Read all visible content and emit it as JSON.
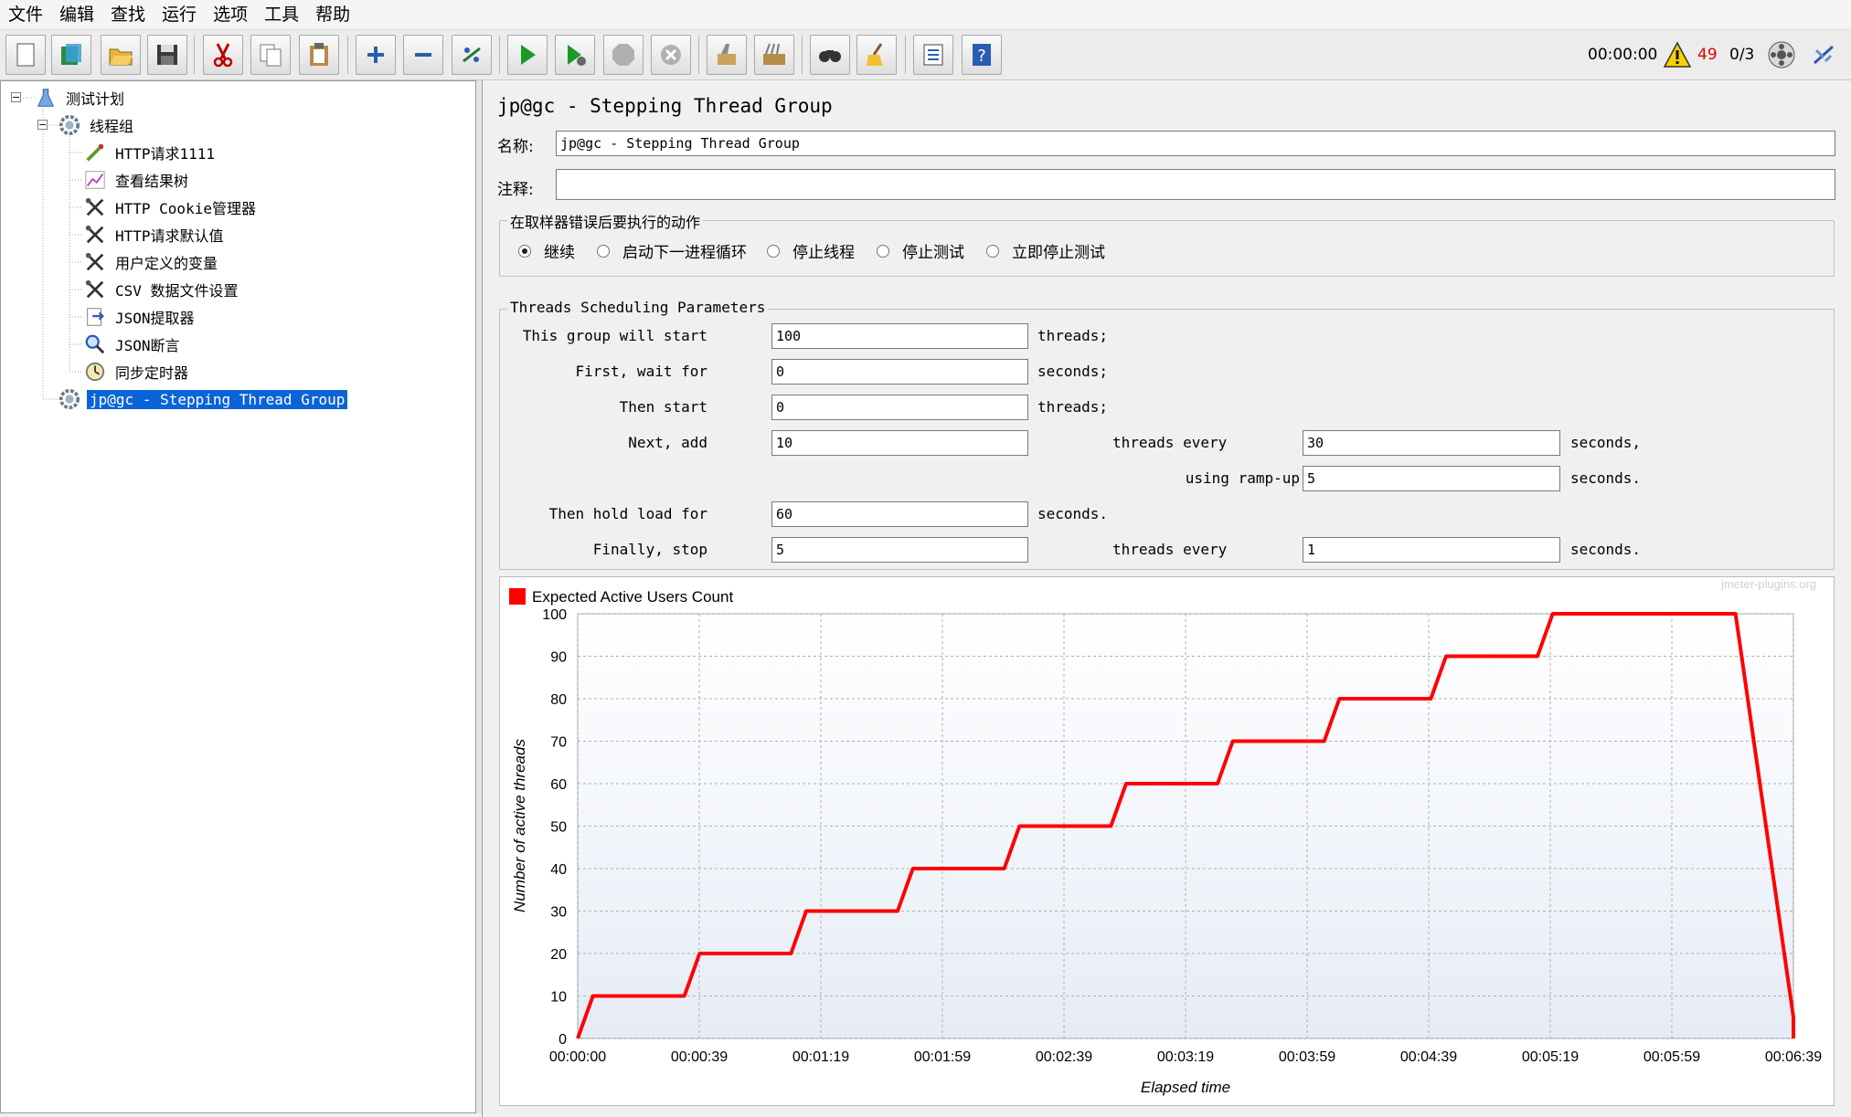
{
  "menu": [
    "文件",
    "编辑",
    "查找",
    "运行",
    "选项",
    "工具",
    "帮助"
  ],
  "toolbar": {
    "buttons": [
      "new-icon",
      "templates-icon",
      "open-icon",
      "save-icon",
      "cut-icon",
      "copy-icon",
      "paste-icon",
      "expand-icon",
      "collapse-icon",
      "toggle-icon",
      "start-icon",
      "start-no-pause-icon",
      "stop-icon",
      "shutdown-icon",
      "clear-icon",
      "clear-all-icon",
      "search-icon",
      "reset-search-icon",
      "function-helper-icon",
      "help-icon"
    ],
    "elapsed": "00:00:00",
    "warning_count": "49",
    "threads": "0/3"
  },
  "tree": {
    "root": "测试计划",
    "thread_group": "线程组",
    "children": [
      "HTTP请求1111",
      "查看结果树",
      "HTTP Cookie管理器",
      "HTTP请求默认值",
      "用户定义的变量",
      "CSV 数据文件设置",
      "JSON提取器",
      "JSON断言",
      "同步定时器"
    ],
    "selected": "jp@gc - Stepping Thread Group"
  },
  "panel": {
    "title": "jp@gc - Stepping Thread Group",
    "name_label": "名称:",
    "name_value": "jp@gc - Stepping Thread Group",
    "comment_label": "注释:",
    "comment_value": "",
    "error_group_title": "在取样器错误后要执行的动作",
    "error_options": [
      "继续",
      "启动下一进程循环",
      "停止线程",
      "停止测试",
      "立即停止测试"
    ],
    "error_selected": 0,
    "sched_title": "Threads Scheduling Parameters",
    "start_label": "This group will start",
    "start_value": "100",
    "threads_unit": "threads;",
    "wait_label": "First, wait for",
    "wait_value": "0",
    "seconds_unit": "seconds;",
    "then_start_label": "Then start",
    "then_start_value": "0",
    "next_add_label": "Next, add",
    "next_add_value": "10",
    "threads_every_label": "threads every",
    "every_value": "30",
    "seconds_comma": "seconds,",
    "rampup_label": "using ramp-up",
    "rampup_value": "5",
    "seconds_dot": "seconds.",
    "hold_label": "Then hold load for",
    "hold_value": "60",
    "stop_label": "Finally, stop",
    "stop_value": "5",
    "stop_every_value": "1"
  },
  "chart_data": {
    "type": "line",
    "title": "",
    "legend": "Expected Active Users Count",
    "watermark": "jmeter-plugins.org",
    "xlabel": "Elapsed time",
    "ylabel": "Number of active threads",
    "ylim": [
      0,
      100
    ],
    "xlim_seconds": [
      0,
      399
    ],
    "x_ticks": [
      "00:00:00",
      "00:00:39",
      "00:01:19",
      "00:01:59",
      "00:02:39",
      "00:03:19",
      "00:03:59",
      "00:04:39",
      "00:05:19",
      "00:05:59",
      "00:06:39"
    ],
    "y_ticks": [
      0,
      10,
      20,
      30,
      40,
      50,
      60,
      70,
      80,
      90,
      100
    ],
    "color": "#ff0000",
    "series": [
      {
        "name": "Expected Active Users Count",
        "x": [
          0,
          5,
          35,
          40,
          70,
          75,
          105,
          110,
          140,
          145,
          175,
          180,
          210,
          215,
          245,
          250,
          280,
          285,
          315,
          320,
          380,
          381,
          382,
          383,
          384,
          385,
          386,
          387,
          388,
          389,
          390,
          391,
          392,
          393,
          394,
          395,
          396,
          397,
          398,
          399,
          400
        ],
        "y": [
          0,
          10,
          10,
          20,
          20,
          30,
          30,
          40,
          40,
          50,
          50,
          60,
          60,
          70,
          70,
          80,
          80,
          90,
          90,
          100,
          100,
          95,
          90,
          85,
          80,
          75,
          70,
          65,
          60,
          55,
          50,
          45,
          40,
          35,
          30,
          25,
          20,
          15,
          10,
          5,
          0
        ]
      }
    ]
  }
}
